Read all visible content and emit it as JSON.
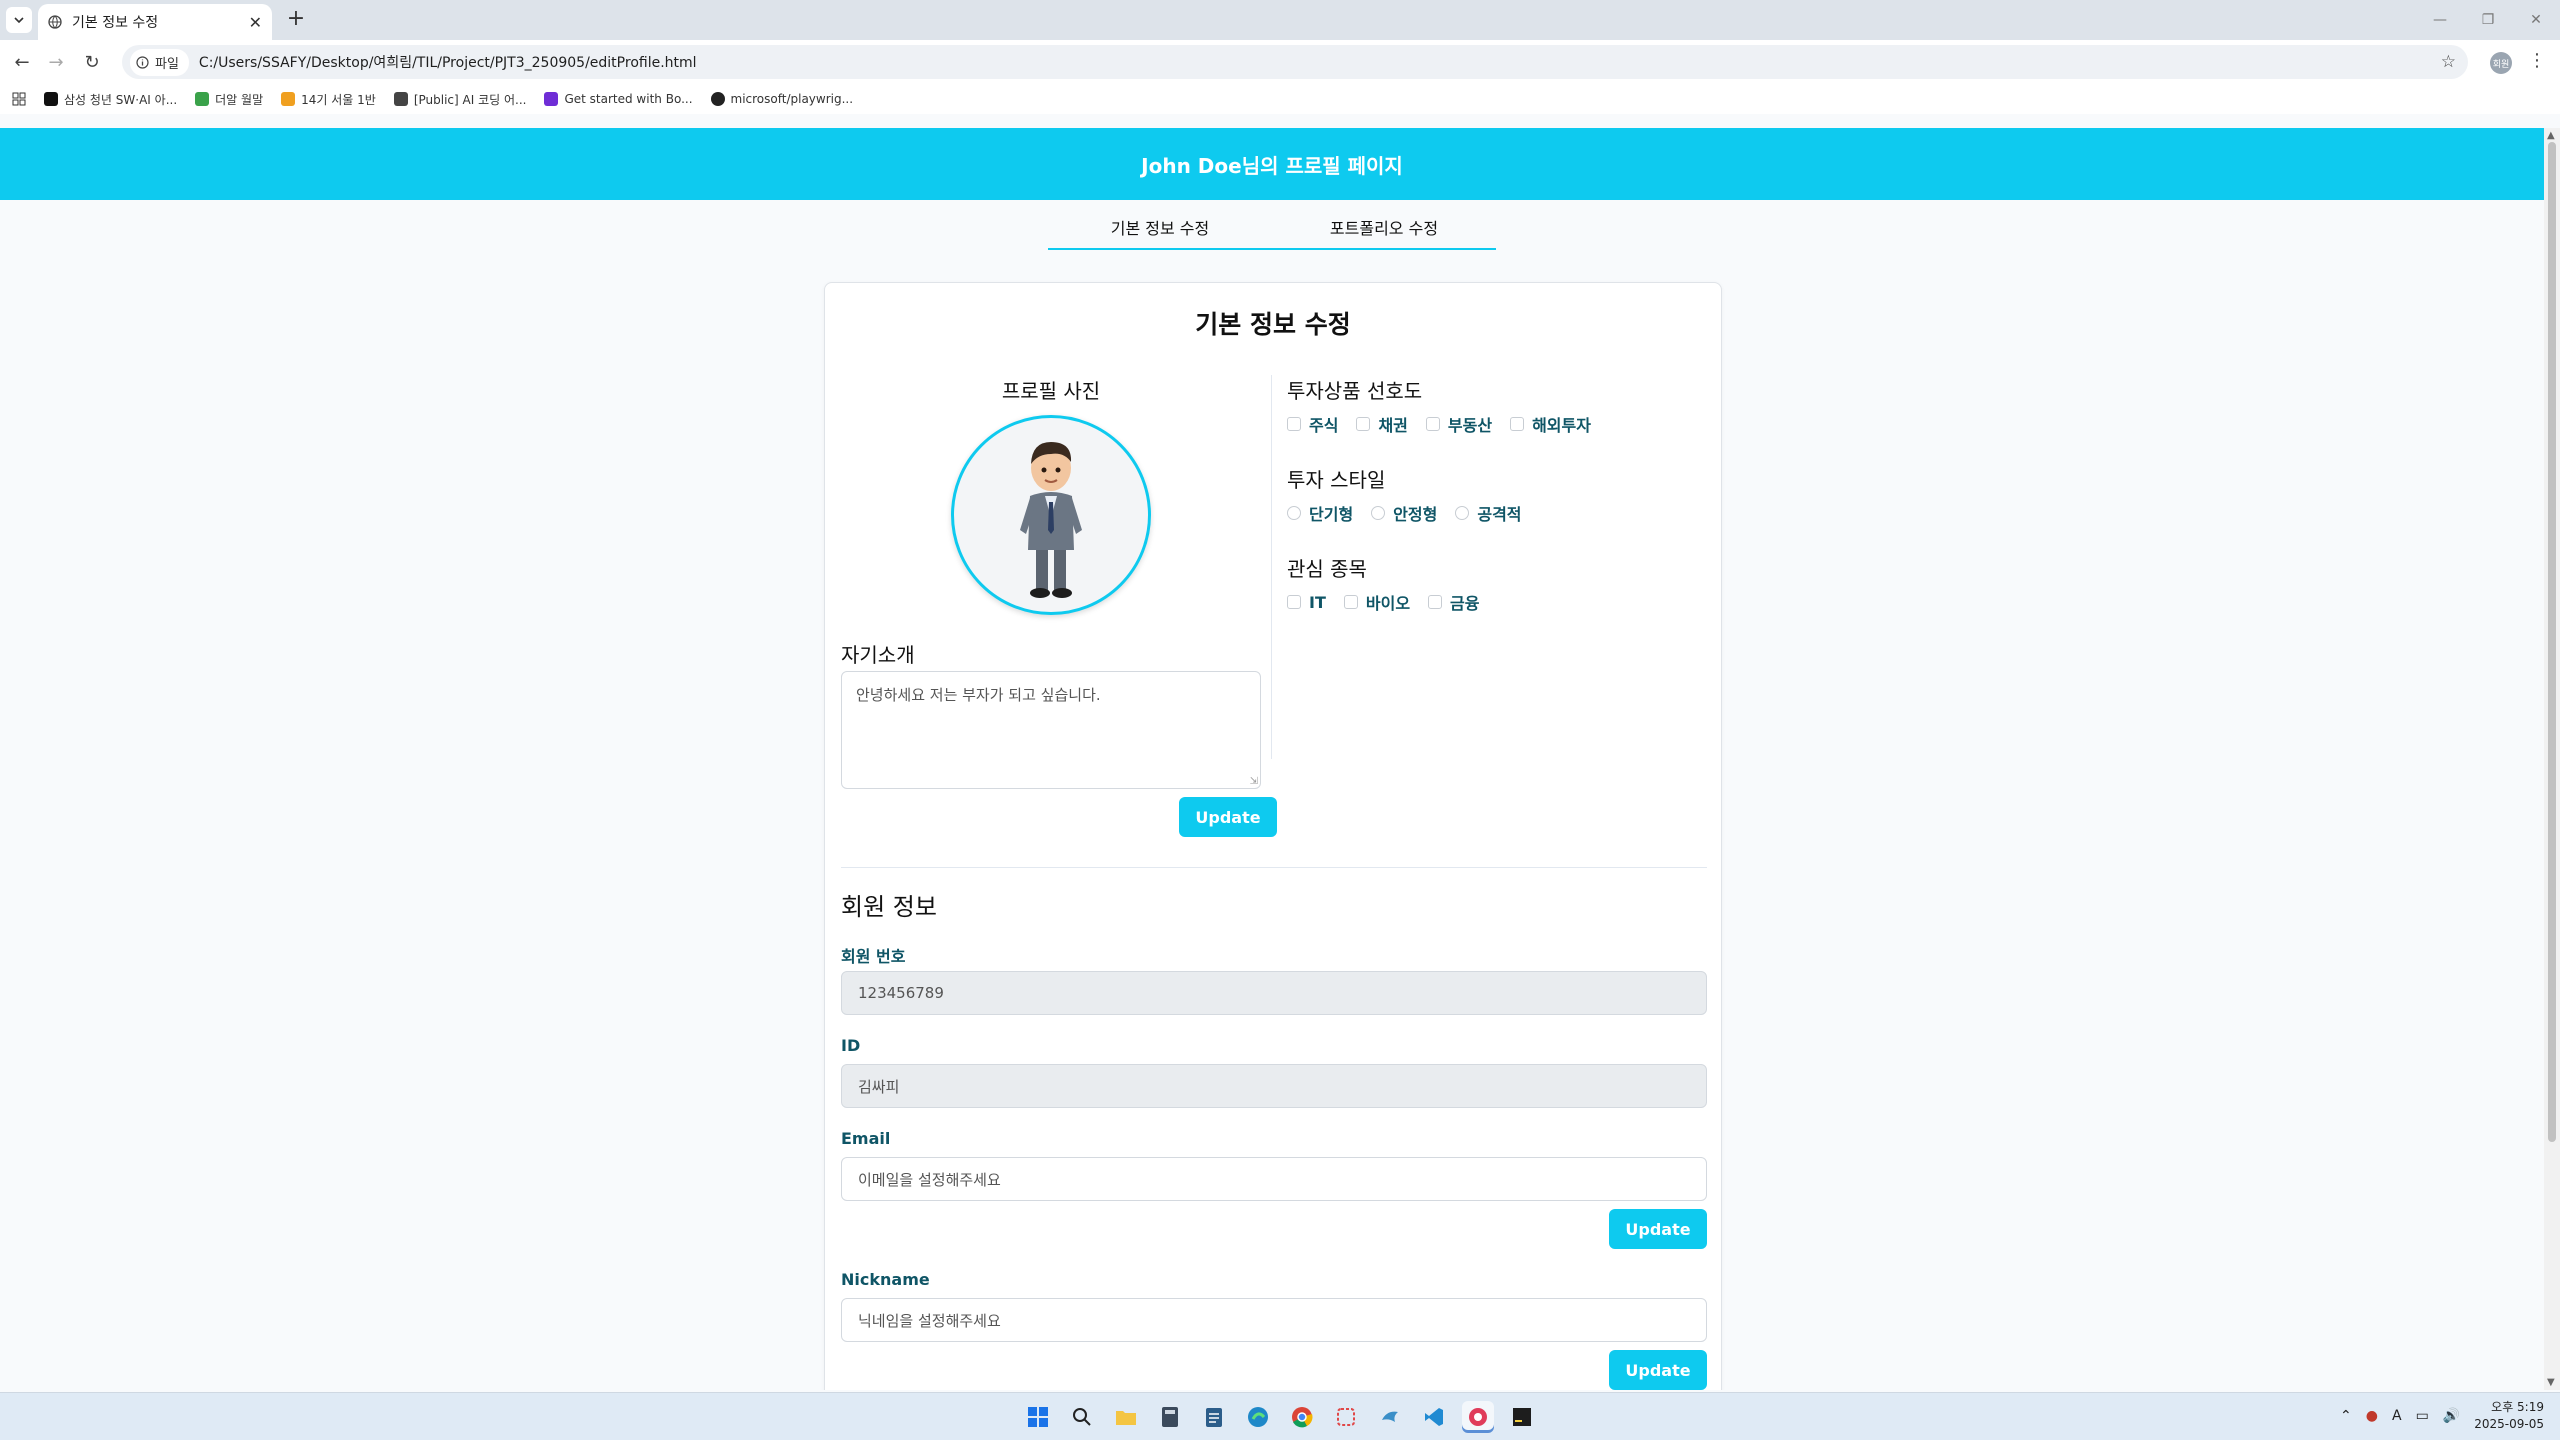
{
  "browser": {
    "tab_title": "기본 정보 수정",
    "tab_close": "✕",
    "new_tab": "+",
    "site_chip": "파일",
    "url": "C:/Users/SSAFY/Desktop/여희림/TIL/Project/PJT3_250905/editProfile.html",
    "profile_initials": "회원",
    "bookmarks": [
      {
        "label": "삼성 청년 SW·AI 아...",
        "color": "#111111"
      },
      {
        "label": "더알 월말",
        "color": "#3aa24a"
      },
      {
        "label": "14기 서울 1반",
        "color": "#f0a020"
      },
      {
        "label": "[Public] AI 코딩 어...",
        "color": "#444444"
      },
      {
        "label": "Get started with Bo...",
        "color": "#6f2dd6"
      },
      {
        "label": "microsoft/playwrig...",
        "color": "#222222"
      }
    ]
  },
  "header": {
    "title": "John Doe님의 프로필 페이지"
  },
  "subnav": {
    "tabs": [
      "기본 정보 수정",
      "포트폴리오 수정"
    ]
  },
  "card": {
    "title": "기본 정보 수정",
    "photo_label": "프로필 사진",
    "bio_label": "자기소개",
    "bio_text": "안녕하세요 저는 부자가 되고 싶습니다.",
    "update_label": "Update"
  },
  "preferences": {
    "products": {
      "title": "투자상품 선호도",
      "options": [
        "주식",
        "채권",
        "부동산",
        "해외투자"
      ]
    },
    "style": {
      "title": "투자 스타일",
      "options": [
        "단기형",
        "안정형",
        "공격적"
      ]
    },
    "interest": {
      "title": "관심 종목",
      "options": [
        "IT",
        "바이오",
        "금융"
      ]
    }
  },
  "member": {
    "title": "회원 정보",
    "number_label": "회원 번호",
    "number_value": "123456789",
    "id_label": "ID",
    "id_value": "김싸피",
    "email_label": "Email",
    "email_placeholder": "이메일을 설정해주세요",
    "nickname_label": "Nickname",
    "nickname_placeholder": "닉네임을 설정해주세요",
    "update_label": "Update"
  },
  "taskbar": {
    "time": "오후 5:19",
    "date": "2025-09-05"
  },
  "colors": {
    "accent": "#0ecaef",
    "label_text": "#0f5566"
  }
}
